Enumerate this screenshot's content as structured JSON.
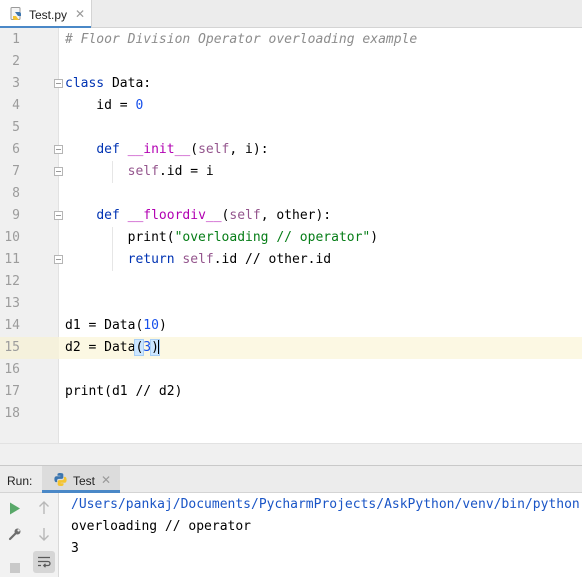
{
  "editor_tab": {
    "filename": "Test.py",
    "close_glyph": "✕"
  },
  "editor": {
    "current_line": 15,
    "lines": [
      {
        "n": "1",
        "tokens": [
          [
            "comment",
            "# Floor Division Operator overloading example"
          ]
        ]
      },
      {
        "n": "2",
        "tokens": []
      },
      {
        "n": "3",
        "tokens": [
          [
            "kw",
            "class"
          ],
          [
            "plain",
            " Data:"
          ]
        ]
      },
      {
        "n": "4",
        "tokens": [
          [
            "plain",
            "    id = "
          ],
          [
            "num",
            "0"
          ]
        ]
      },
      {
        "n": "5",
        "tokens": []
      },
      {
        "n": "6",
        "tokens": [
          [
            "plain",
            "    "
          ],
          [
            "kw",
            "def"
          ],
          [
            "plain",
            " "
          ],
          [
            "fn",
            "__init__"
          ],
          [
            "plain",
            "("
          ],
          [
            "self",
            "self"
          ],
          [
            "plain",
            ", i):"
          ]
        ]
      },
      {
        "n": "7",
        "tokens": [
          [
            "plain",
            "        "
          ],
          [
            "self",
            "self"
          ],
          [
            "plain",
            ".id = i"
          ]
        ]
      },
      {
        "n": "8",
        "tokens": []
      },
      {
        "n": "9",
        "tokens": [
          [
            "plain",
            "    "
          ],
          [
            "kw",
            "def"
          ],
          [
            "plain",
            " "
          ],
          [
            "fn",
            "__floordiv__"
          ],
          [
            "plain",
            "("
          ],
          [
            "self",
            "self"
          ],
          [
            "plain",
            ", other):"
          ]
        ]
      },
      {
        "n": "10",
        "tokens": [
          [
            "plain",
            "        print("
          ],
          [
            "str",
            "\"overloading // operator\""
          ],
          [
            "plain",
            ")"
          ]
        ]
      },
      {
        "n": "11",
        "tokens": [
          [
            "plain",
            "        "
          ],
          [
            "kw",
            "return"
          ],
          [
            "plain",
            " "
          ],
          [
            "self",
            "self"
          ],
          [
            "plain",
            ".id // other.id"
          ]
        ]
      },
      {
        "n": "12",
        "tokens": []
      },
      {
        "n": "13",
        "tokens": []
      },
      {
        "n": "14",
        "tokens": [
          [
            "plain",
            "d1 = Data("
          ],
          [
            "num",
            "10"
          ],
          [
            "plain",
            ")"
          ]
        ]
      },
      {
        "n": "15",
        "tokens": [
          [
            "plain",
            "d2 = Data"
          ],
          [
            "paren",
            "("
          ],
          [
            "num",
            "3"
          ],
          [
            "paren",
            ")"
          ],
          [
            "caret",
            ""
          ]
        ]
      },
      {
        "n": "16",
        "tokens": []
      },
      {
        "n": "17",
        "tokens": [
          [
            "plain",
            "print(d1 // d2)"
          ]
        ]
      },
      {
        "n": "18",
        "tokens": []
      }
    ],
    "fold_markers_at_lines": [
      3,
      6,
      7,
      9,
      11
    ]
  },
  "run_panel": {
    "title": "Run:",
    "tab_label": "Test",
    "close_glyph": "✕",
    "output": [
      {
        "text": "/Users/pankaj/Documents/PycharmProjects/AskPython/venv/bin/python",
        "kind": "link"
      },
      {
        "text": "overloading // operator",
        "kind": "plain"
      },
      {
        "text": "3",
        "kind": "plain"
      }
    ]
  },
  "colors": {
    "accent": "#4a88c7",
    "current_line": "#fcf8e3",
    "run_green": "#59a869"
  },
  "icons": {
    "tab_file": "python-file-icon",
    "run_tab": "python-icon",
    "toolbar": [
      "rerun-icon",
      "scroll-up-icon",
      "settings-wrench-icon",
      "scroll-down-icon",
      "stop-icon",
      "soft-wrap-icon"
    ]
  }
}
